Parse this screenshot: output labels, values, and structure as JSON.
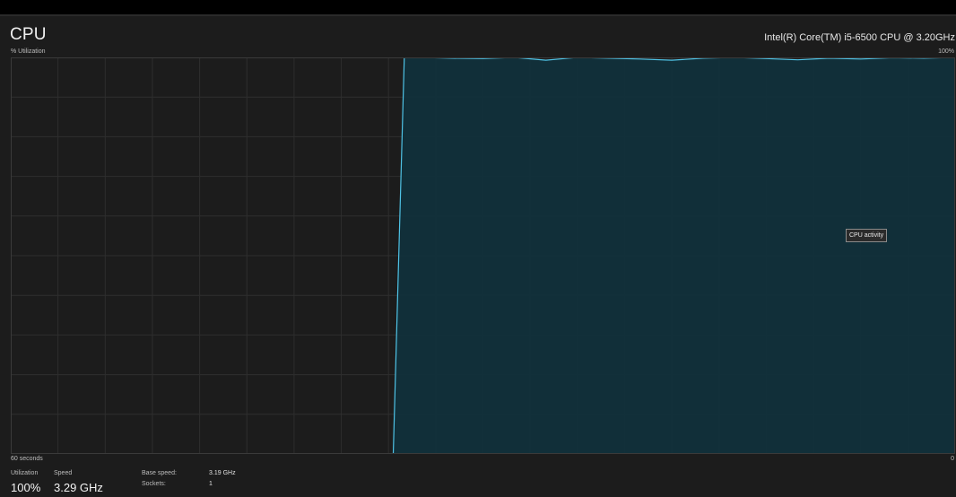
{
  "header": {
    "title": "CPU",
    "cpu_model": "Intel(R) Core(TM) i5-6500 CPU @ 3.20GHz"
  },
  "graph": {
    "y_label": "% Utilization",
    "y_max_label": "100%",
    "x_left_label": "60 seconds",
    "x_right_label": "0",
    "tooltip": "CPU activity",
    "line_color": "#4fc3e6",
    "fill_color": "#11303b",
    "grid_color": "#2e2e2e"
  },
  "chart_data": {
    "type": "area",
    "xlabel": "",
    "ylabel": "% Utilization",
    "xlim": [
      60,
      0
    ],
    "ylim": [
      0,
      100
    ],
    "grid": true,
    "x": [
      60,
      35.7,
      35.0,
      33.9,
      32.0,
      30.0,
      28.0,
      26.0,
      24.0,
      22.0,
      20.0,
      18.0,
      16.0,
      14.0,
      12.0,
      10.0,
      8.0,
      6.0,
      4.0,
      2.0,
      0
    ],
    "values": [
      0,
      0,
      100,
      100,
      99.8,
      99.7,
      100,
      99.3,
      100,
      99.8,
      99.6,
      99.3,
      99.8,
      100,
      99.7,
      99.4,
      99.8,
      99.6,
      99.9,
      99.8,
      100
    ]
  },
  "stats": {
    "utilization_label": "Utilization",
    "utilization_value": "100%",
    "speed_label": "Speed",
    "speed_value": "3.29 GHz",
    "base_speed_label": "Base speed:",
    "base_speed_value": "3.19 GHz",
    "sockets_label": "Sockets:",
    "sockets_value": "1"
  }
}
